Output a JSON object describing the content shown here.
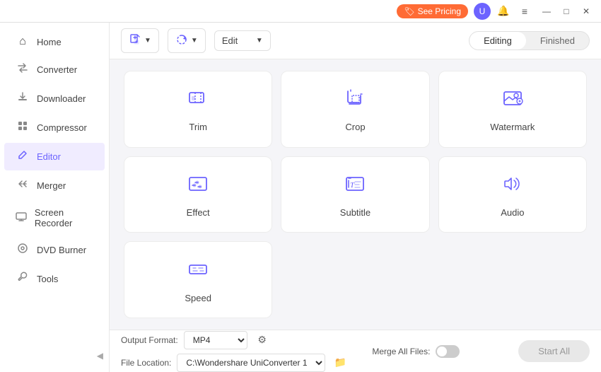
{
  "titleBar": {
    "seePricing": "See Pricing",
    "avatar": "U",
    "notifIcon": "🔔",
    "menuIcon": "≡",
    "minIcon": "—",
    "maxIcon": "□",
    "closeIcon": "✕"
  },
  "sidebar": {
    "items": [
      {
        "id": "home",
        "label": "Home",
        "icon": "⌂"
      },
      {
        "id": "converter",
        "label": "Converter",
        "icon": "⇄"
      },
      {
        "id": "downloader",
        "label": "Downloader",
        "icon": "⬇"
      },
      {
        "id": "compressor",
        "label": "Compressor",
        "icon": "⬛"
      },
      {
        "id": "editor",
        "label": "Editor",
        "icon": "✏"
      },
      {
        "id": "merger",
        "label": "Merger",
        "icon": "⊕"
      },
      {
        "id": "screen-recorder",
        "label": "Screen Recorder",
        "icon": "⊡"
      },
      {
        "id": "dvd-burner",
        "label": "DVD Burner",
        "icon": "⊙"
      },
      {
        "id": "tools",
        "label": "Tools",
        "icon": "⚙"
      }
    ],
    "collapseIcon": "◀"
  },
  "toolbar": {
    "addFileLabel": "+",
    "addFileIcon": "📄",
    "addFromIcon": "🔄",
    "editDropdown": "Edit",
    "tabs": [
      {
        "id": "editing",
        "label": "Editing",
        "active": true
      },
      {
        "id": "finished",
        "label": "Finished",
        "active": false
      }
    ]
  },
  "editorTools": [
    {
      "id": "trim",
      "label": "Trim"
    },
    {
      "id": "crop",
      "label": "Crop"
    },
    {
      "id": "watermark",
      "label": "Watermark"
    },
    {
      "id": "effect",
      "label": "Effect"
    },
    {
      "id": "subtitle",
      "label": "Subtitle"
    },
    {
      "id": "audio",
      "label": "Audio"
    },
    {
      "id": "speed",
      "label": "Speed"
    }
  ],
  "bottomBar": {
    "outputFormatLabel": "Output Format:",
    "outputFormatValue": "MP4",
    "fileLocationLabel": "File Location:",
    "fileLocationValue": "C:\\Wondershare UniConverter 1",
    "mergeAllLabel": "Merge All Files:",
    "startAllLabel": "Start All"
  }
}
